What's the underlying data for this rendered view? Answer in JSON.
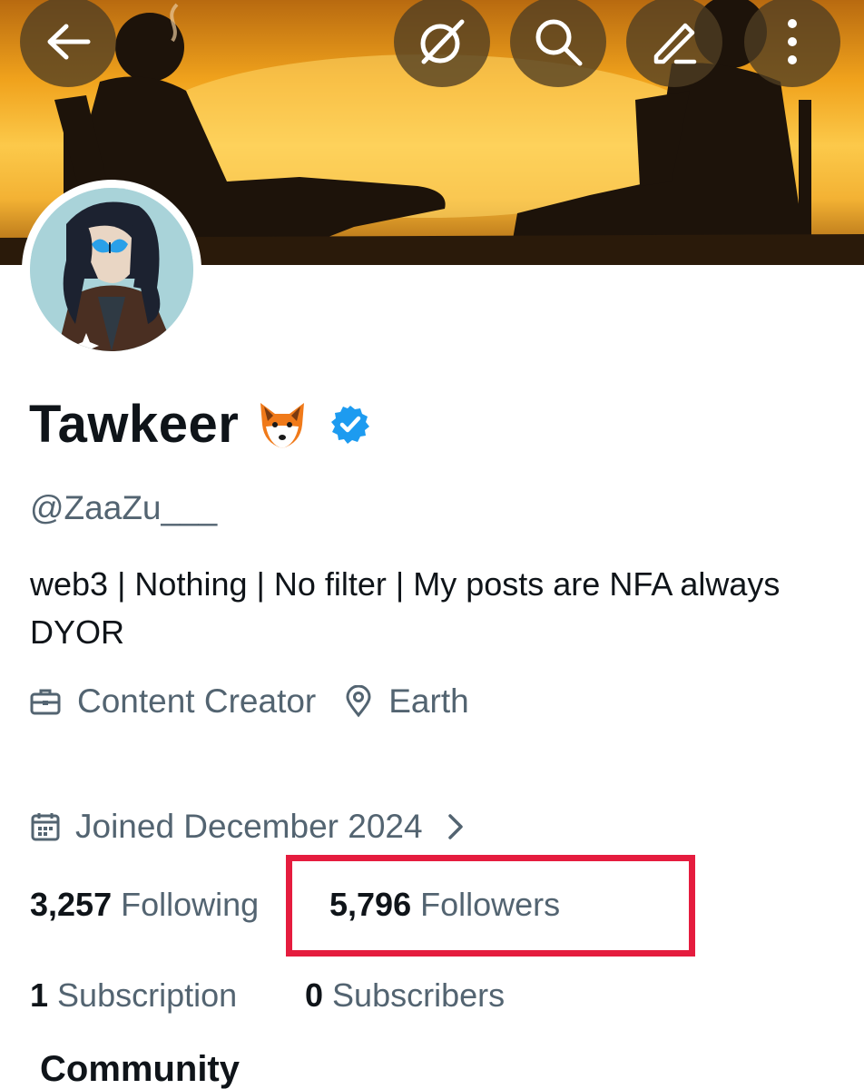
{
  "profile": {
    "display_name": "Tawkeer",
    "name_emoji": "🦊",
    "handle": "@ZaaZu___",
    "bio": "web3 | Nothing | No filter |  My posts are NFA always DYOR",
    "category": "Content Creator",
    "location": "Earth",
    "joined": "Joined December 2024"
  },
  "stats": {
    "following_count": "3,257",
    "following_label": "Following",
    "followers_count": "5,796",
    "followers_label": "Followers",
    "subscriptions_count": "1",
    "subscriptions_label": "Subscription",
    "subscribers_count": "0",
    "subscribers_label": "Subscribers"
  },
  "section": {
    "title": "Community"
  },
  "icons": {
    "back": "arrow-left-icon",
    "grok": "grok-slash-icon",
    "search": "search-icon",
    "edit": "edit-icon",
    "more": "more-vertical-icon",
    "category": "briefcase-icon",
    "location": "location-pin-icon",
    "joined": "calendar-icon",
    "chevron": "chevron-right-icon",
    "verified": "verified-badge-icon"
  },
  "colors": {
    "highlight_box": "#e51c3e",
    "verified_blue": "#1d9bf0",
    "secondary_text": "#536471",
    "primary_text": "#0f1419"
  }
}
